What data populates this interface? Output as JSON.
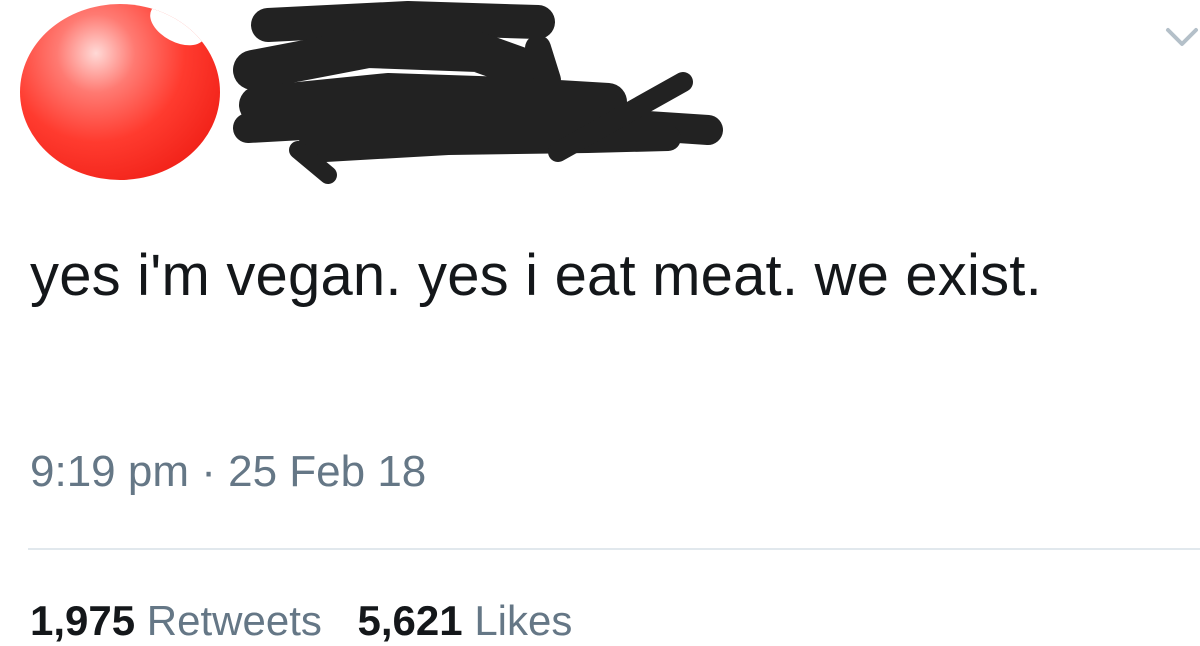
{
  "tweet": {
    "text": "yes i'm vegan. yes i eat meat. we exist.",
    "time": "9:19 pm",
    "separator": "·",
    "date": "25 Feb 18"
  },
  "stats": {
    "retweets_count": "1,975",
    "retweets_label": "Retweets",
    "likes_count": "5,621",
    "likes_label": "Likes"
  },
  "icons": {
    "avatar": "red-sphere-avatar",
    "menu": "chevron-down-icon"
  },
  "colors": {
    "text": "#14171a",
    "secondary": "#657786",
    "divider": "#e1e8ed",
    "avatar": "#ff3b2f",
    "redaction": "#222222"
  }
}
